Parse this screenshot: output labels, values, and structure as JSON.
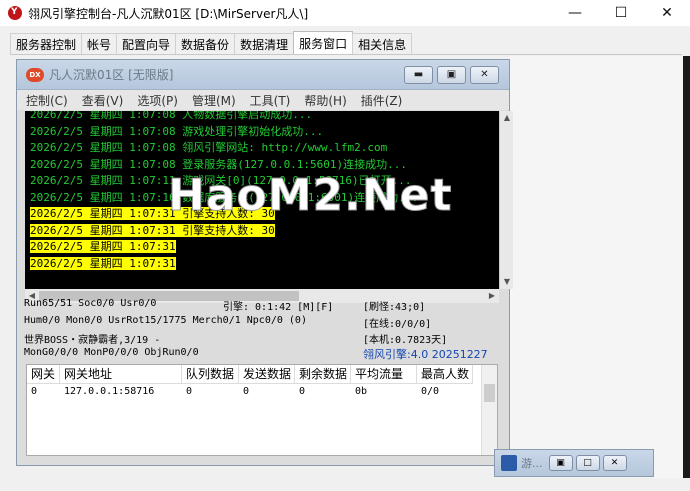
{
  "window": {
    "title": "翎风引擎控制台-凡人沉默01区 [D:\\MirServer凡人\\]"
  },
  "tabs": [
    {
      "label": "服务器控制",
      "active": false
    },
    {
      "label": "帐号",
      "active": false
    },
    {
      "label": "配置向导",
      "active": false
    },
    {
      "label": "数据备份",
      "active": false
    },
    {
      "label": "数据清理",
      "active": false
    },
    {
      "label": "服务窗口",
      "active": true
    },
    {
      "label": "相关信息",
      "active": false
    }
  ],
  "inner": {
    "icon_text": "DX",
    "title": "凡人沉默01区 [无限版]",
    "menu": [
      "控制(C)",
      "查看(V)",
      "选项(P)",
      "管理(M)",
      "工具(T)",
      "帮助(H)",
      "插件(Z)"
    ]
  },
  "log": [
    {
      "text": "2026/2/5 星期四 1:07:08 人物数据引擎启动成功...",
      "highlight": false
    },
    {
      "text": "2026/2/5 星期四 1:07:08 游戏处理引擎初始化成功...",
      "highlight": false
    },
    {
      "text": "2026/2/5 星期四 1:07:08 翎风引擎网站: http://www.lfm2.com",
      "highlight": false
    },
    {
      "text": "2026/2/5 星期四 1:07:08 登录服务器(127.0.0.1:5601)连接成功...",
      "highlight": false
    },
    {
      "text": "2026/2/5 星期四 1:07:11 游戏网关[0](127.0.0.1:58716)已打开...",
      "highlight": false
    },
    {
      "text": "2026/2/5 星期四 1:07:16 数据库服务器(127.0.0.1:6001)连接成功...",
      "highlight": false
    },
    {
      "text": "2026/2/5 星期四 1:07:31 引擎支持人数: 30",
      "highlight": true
    },
    {
      "text": "2026/2/5 星期四 1:07:31 引擎支持人数: 30",
      "highlight": true
    },
    {
      "text": "2026/2/5 星期四 1:07:31",
      "highlight": true
    },
    {
      "text": "2026/2/5 星期四 1:07:31",
      "highlight": true
    }
  ],
  "watermark": "HaoM2.Net",
  "status": {
    "line1_left": "Run65/51 Soc0/0 Usr0/0",
    "line1_mid": "引擎: 0:1:42 [M][F]",
    "line1_right": "[刷怪:43;0]",
    "line2_left": "Hum0/0 Mon0/0 UsrRot15/1775 Merch0/1 Npc0/0 (0)",
    "line2_right": "[在线:0/0/0]",
    "line3_left": "世界BOSS・寂静霸者,3/19 -",
    "line3_right": "[本机:0.7823天]",
    "line4_left": "MonG0/0/0 MonP0/0/0 ObjRun0/0",
    "line4_right": "翎风引擎:4.0 20251227"
  },
  "gateway": {
    "headers": [
      "网关",
      "网关地址",
      "队列数据",
      "发送数据",
      "剩余数据",
      "平均流量",
      "最高人数"
    ],
    "rows": [
      [
        "0",
        "127.0.0.1:58716",
        "0",
        "0",
        "0",
        "0b",
        "0/0"
      ]
    ]
  },
  "minimized": {
    "title": "游..."
  }
}
